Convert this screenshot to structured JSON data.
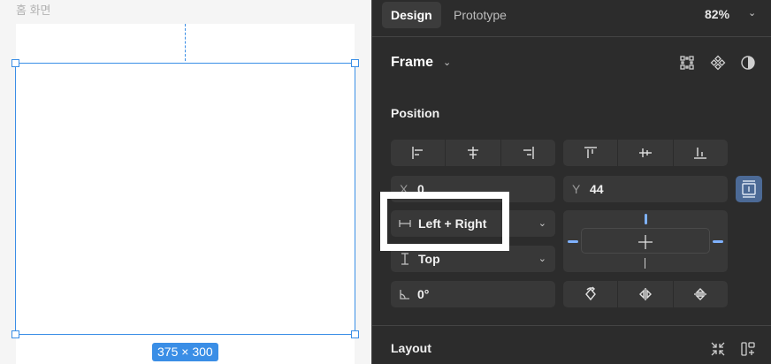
{
  "canvas": {
    "frame_title": "홈 화면",
    "size_badge": "375 × 300"
  },
  "panel": {
    "tabs": [
      {
        "label": "Design",
        "active": true
      },
      {
        "label": "Prototype",
        "active": false
      }
    ],
    "zoom": "82%",
    "frame_label": "Frame",
    "position_title": "Position",
    "x_label": "X",
    "x_value": "0",
    "y_label": "Y",
    "y_value": "44",
    "horizontal_constraint": "Left + Right",
    "vertical_constraint": "Top",
    "rotation_value": "0°",
    "layout_title": "Layout"
  },
  "colors": {
    "accent": "#3a8ee6",
    "panel_bg": "#2c2c2c",
    "control_bg": "#383838",
    "constraint_blue": "#7fb2ff",
    "clip_button": "#4c6a96"
  }
}
